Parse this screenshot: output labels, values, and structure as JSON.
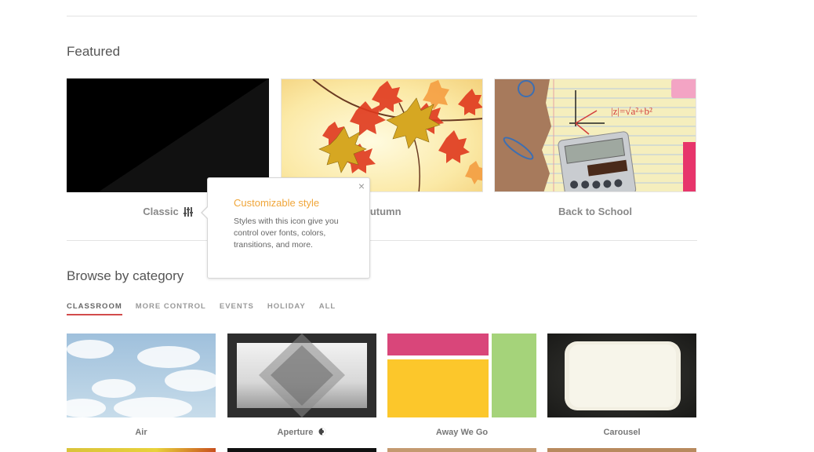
{
  "sections": {
    "featured_title": "Featured",
    "browse_title": "Browse by category"
  },
  "featured": [
    {
      "label": "Classic",
      "customizable": true
    },
    {
      "label": "Autumn"
    },
    {
      "label": "Back to School"
    }
  ],
  "tooltip": {
    "title": "Customizable style",
    "body": "Styles with this icon give you control over fonts, colors, transitions, and more.",
    "close": "×"
  },
  "tabs": [
    {
      "label": "CLASSROOM",
      "active": true
    },
    {
      "label": "MORE CONTROL"
    },
    {
      "label": "EVENTS"
    },
    {
      "label": "HOLIDAY"
    },
    {
      "label": "ALL"
    }
  ],
  "categories": [
    {
      "label": "Air"
    },
    {
      "label": "Aperture",
      "customizable": true
    },
    {
      "label": "Away We Go"
    },
    {
      "label": "Carousel"
    }
  ],
  "colors": {
    "accent_orange": "#f0a63a",
    "tab_underline": "#d24b4b",
    "away_pink": "#d9467a",
    "away_yellow": "#fcc72b",
    "away_green": "#a5d37a"
  }
}
